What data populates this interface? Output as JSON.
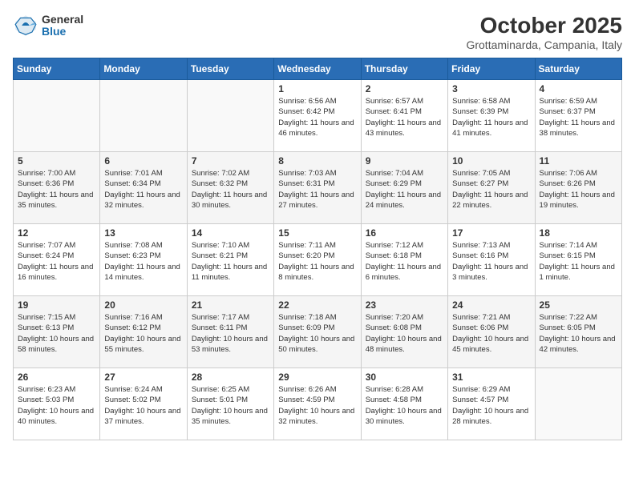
{
  "logo": {
    "general": "General",
    "blue": "Blue"
  },
  "title": "October 2025",
  "location": "Grottaminarda, Campania, Italy",
  "days_of_week": [
    "Sunday",
    "Monday",
    "Tuesday",
    "Wednesday",
    "Thursday",
    "Friday",
    "Saturday"
  ],
  "weeks": [
    [
      {
        "day": "",
        "info": ""
      },
      {
        "day": "",
        "info": ""
      },
      {
        "day": "",
        "info": ""
      },
      {
        "day": "1",
        "info": "Sunrise: 6:56 AM\nSunset: 6:42 PM\nDaylight: 11 hours and 46 minutes."
      },
      {
        "day": "2",
        "info": "Sunrise: 6:57 AM\nSunset: 6:41 PM\nDaylight: 11 hours and 43 minutes."
      },
      {
        "day": "3",
        "info": "Sunrise: 6:58 AM\nSunset: 6:39 PM\nDaylight: 11 hours and 41 minutes."
      },
      {
        "day": "4",
        "info": "Sunrise: 6:59 AM\nSunset: 6:37 PM\nDaylight: 11 hours and 38 minutes."
      }
    ],
    [
      {
        "day": "5",
        "info": "Sunrise: 7:00 AM\nSunset: 6:36 PM\nDaylight: 11 hours and 35 minutes."
      },
      {
        "day": "6",
        "info": "Sunrise: 7:01 AM\nSunset: 6:34 PM\nDaylight: 11 hours and 32 minutes."
      },
      {
        "day": "7",
        "info": "Sunrise: 7:02 AM\nSunset: 6:32 PM\nDaylight: 11 hours and 30 minutes."
      },
      {
        "day": "8",
        "info": "Sunrise: 7:03 AM\nSunset: 6:31 PM\nDaylight: 11 hours and 27 minutes."
      },
      {
        "day": "9",
        "info": "Sunrise: 7:04 AM\nSunset: 6:29 PM\nDaylight: 11 hours and 24 minutes."
      },
      {
        "day": "10",
        "info": "Sunrise: 7:05 AM\nSunset: 6:27 PM\nDaylight: 11 hours and 22 minutes."
      },
      {
        "day": "11",
        "info": "Sunrise: 7:06 AM\nSunset: 6:26 PM\nDaylight: 11 hours and 19 minutes."
      }
    ],
    [
      {
        "day": "12",
        "info": "Sunrise: 7:07 AM\nSunset: 6:24 PM\nDaylight: 11 hours and 16 minutes."
      },
      {
        "day": "13",
        "info": "Sunrise: 7:08 AM\nSunset: 6:23 PM\nDaylight: 11 hours and 14 minutes."
      },
      {
        "day": "14",
        "info": "Sunrise: 7:10 AM\nSunset: 6:21 PM\nDaylight: 11 hours and 11 minutes."
      },
      {
        "day": "15",
        "info": "Sunrise: 7:11 AM\nSunset: 6:20 PM\nDaylight: 11 hours and 8 minutes."
      },
      {
        "day": "16",
        "info": "Sunrise: 7:12 AM\nSunset: 6:18 PM\nDaylight: 11 hours and 6 minutes."
      },
      {
        "day": "17",
        "info": "Sunrise: 7:13 AM\nSunset: 6:16 PM\nDaylight: 11 hours and 3 minutes."
      },
      {
        "day": "18",
        "info": "Sunrise: 7:14 AM\nSunset: 6:15 PM\nDaylight: 11 hours and 1 minute."
      }
    ],
    [
      {
        "day": "19",
        "info": "Sunrise: 7:15 AM\nSunset: 6:13 PM\nDaylight: 10 hours and 58 minutes."
      },
      {
        "day": "20",
        "info": "Sunrise: 7:16 AM\nSunset: 6:12 PM\nDaylight: 10 hours and 55 minutes."
      },
      {
        "day": "21",
        "info": "Sunrise: 7:17 AM\nSunset: 6:11 PM\nDaylight: 10 hours and 53 minutes."
      },
      {
        "day": "22",
        "info": "Sunrise: 7:18 AM\nSunset: 6:09 PM\nDaylight: 10 hours and 50 minutes."
      },
      {
        "day": "23",
        "info": "Sunrise: 7:20 AM\nSunset: 6:08 PM\nDaylight: 10 hours and 48 minutes."
      },
      {
        "day": "24",
        "info": "Sunrise: 7:21 AM\nSunset: 6:06 PM\nDaylight: 10 hours and 45 minutes."
      },
      {
        "day": "25",
        "info": "Sunrise: 7:22 AM\nSunset: 6:05 PM\nDaylight: 10 hours and 42 minutes."
      }
    ],
    [
      {
        "day": "26",
        "info": "Sunrise: 6:23 AM\nSunset: 5:03 PM\nDaylight: 10 hours and 40 minutes."
      },
      {
        "day": "27",
        "info": "Sunrise: 6:24 AM\nSunset: 5:02 PM\nDaylight: 10 hours and 37 minutes."
      },
      {
        "day": "28",
        "info": "Sunrise: 6:25 AM\nSunset: 5:01 PM\nDaylight: 10 hours and 35 minutes."
      },
      {
        "day": "29",
        "info": "Sunrise: 6:26 AM\nSunset: 4:59 PM\nDaylight: 10 hours and 32 minutes."
      },
      {
        "day": "30",
        "info": "Sunrise: 6:28 AM\nSunset: 4:58 PM\nDaylight: 10 hours and 30 minutes."
      },
      {
        "day": "31",
        "info": "Sunrise: 6:29 AM\nSunset: 4:57 PM\nDaylight: 10 hours and 28 minutes."
      },
      {
        "day": "",
        "info": ""
      }
    ]
  ]
}
